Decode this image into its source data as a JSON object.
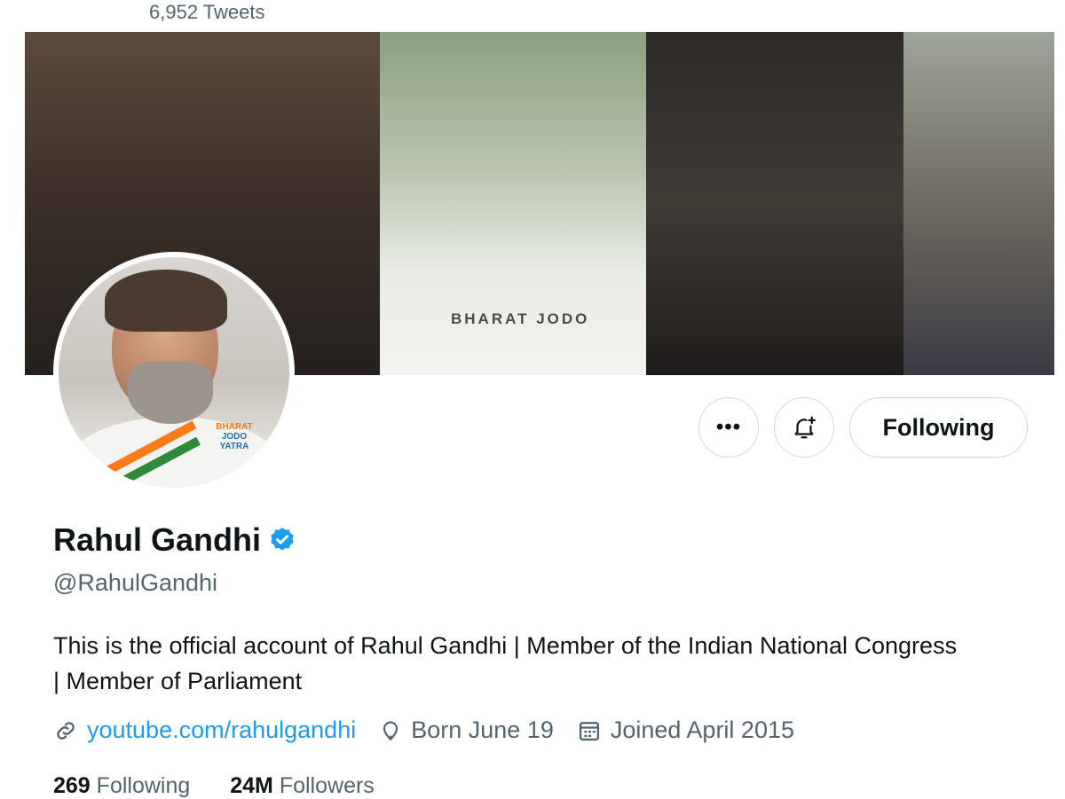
{
  "header": {
    "tweets_count": "6,952 Tweets"
  },
  "banner": {
    "caption": "BHARAT JODO"
  },
  "avatar": {
    "logo_line1": "BHARAT",
    "logo_line2": "JODO",
    "logo_line3": "YATRA"
  },
  "actions": {
    "more_label": "•••",
    "follow_label": "Following"
  },
  "profile": {
    "display_name": "Rahul Gandhi",
    "handle": "@RahulGandhi",
    "bio": "This is the official account of Rahul Gandhi | Member of the Indian National Congress | Member of Parliament",
    "link": "youtube.com/rahulgandhi",
    "born": "Born June 19",
    "joined": "Joined April 2015"
  },
  "stats": {
    "following_count": "269",
    "following_label": "Following",
    "followers_count": "24M",
    "followers_label": "Followers"
  },
  "colors": {
    "accent": "#1d9bf0",
    "muted": "#536471",
    "text": "#0f1419"
  },
  "icons": [
    "verified-badge-icon",
    "link-icon",
    "location-icon",
    "calendar-icon",
    "bell-plus-icon"
  ]
}
